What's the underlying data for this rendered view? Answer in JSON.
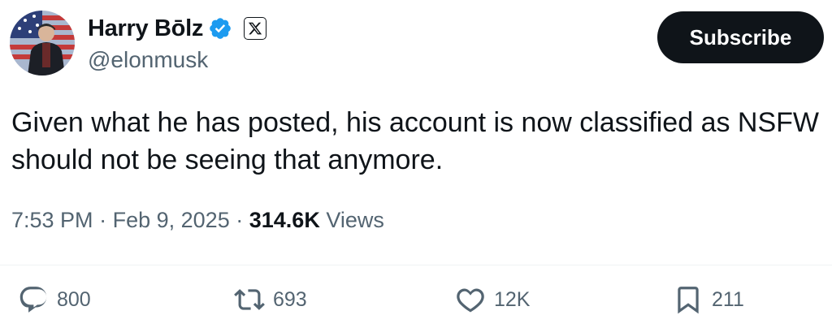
{
  "author": {
    "display_name": "Harry Bōlz",
    "handle": "@elonmusk",
    "verified_icon": "verified-badge-icon",
    "affiliate_icon": "x-logo-icon"
  },
  "subscribe_label": "Subscribe",
  "tweet": {
    "text": "Given what he has posted, his account is now classified as NSFW\nshould not be seeing that anymore."
  },
  "meta": {
    "time": "7:53 PM",
    "date": "Feb 9, 2025",
    "views_count": "314.6K",
    "views_label": "Views",
    "separator": "·"
  },
  "actions": {
    "reply_count": "800",
    "retweet_count": "693",
    "like_count": "12K",
    "bookmark_count": "211"
  },
  "colors": {
    "text_primary": "#0f1419",
    "text_secondary": "#536471",
    "verified_blue": "#1d9bf0",
    "button_bg": "#0f1419"
  }
}
